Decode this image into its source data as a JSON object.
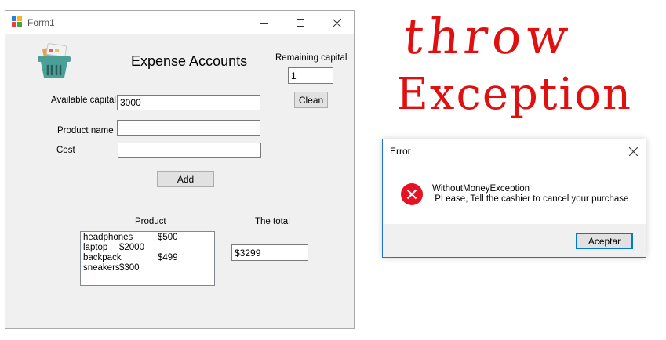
{
  "form": {
    "title": "Form1",
    "heading": "Expense Accounts",
    "remaining_capital_label": "Remaining capital",
    "remaining_capital_value": "1",
    "clean_label": "Clean",
    "available_capital_label": "Available capital",
    "available_capital_value": "3000",
    "product_name_label": "Product name",
    "product_name_value": "",
    "cost_label": "Cost",
    "cost_value": "",
    "add_label": "Add",
    "product_column_label": "Product",
    "total_column_label": "The total",
    "products": [
      {
        "name": "headphones",
        "price": "$500"
      },
      {
        "name": "laptop",
        "price": "$2000"
      },
      {
        "name": "backpack",
        "price": "$499"
      },
      {
        "name": "sneakers",
        "price": "$300"
      }
    ],
    "total_value": "$3299",
    "icon": "shopping-basket-icon"
  },
  "annotation": {
    "text_line1": "throw",
    "text_line2": "Exception",
    "color": "#e01010"
  },
  "error_dialog": {
    "title": "Error",
    "message_line1": "WithoutMoneyException",
    "message_line2": " PLease, Tell the cashier to cancel your purchase",
    "ok_label": "Aceptar",
    "icon": "error-icon",
    "accent": "#0078d7",
    "error_color": "#e81123"
  }
}
